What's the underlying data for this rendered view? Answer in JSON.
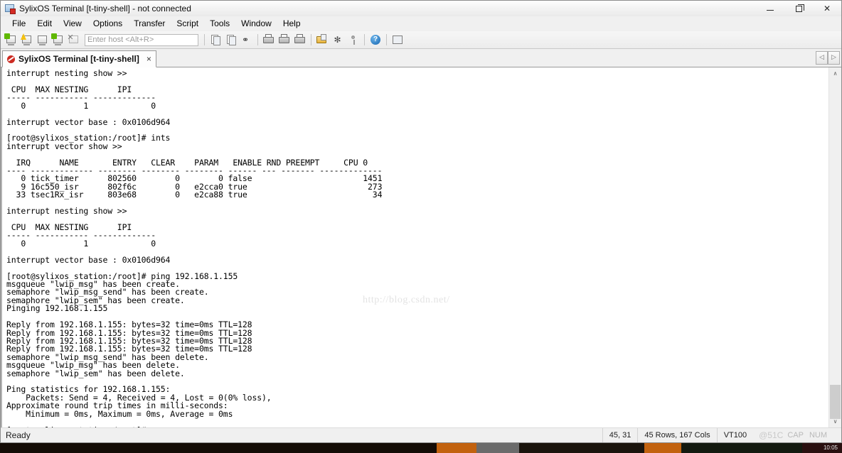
{
  "window": {
    "title": "SylixOS Terminal [t-tiny-shell] - not connected",
    "icon": "terminal-app-icon",
    "minimize": "minimize-icon",
    "maximize": "restore-icon",
    "close": "close-icon"
  },
  "menubar": {
    "items": [
      {
        "label": "File"
      },
      {
        "label": "Edit"
      },
      {
        "label": "View"
      },
      {
        "label": "Options"
      },
      {
        "label": "Transfer"
      },
      {
        "label": "Script"
      },
      {
        "label": "Tools"
      },
      {
        "label": "Window"
      },
      {
        "label": "Help"
      }
    ]
  },
  "toolbar": {
    "host_placeholder": "Enter host <Alt+R>",
    "host_value": "",
    "icons": [
      {
        "name": "connect-icon"
      },
      {
        "name": "quick-connect-icon"
      },
      {
        "name": "connect-in-tab-icon"
      },
      {
        "name": "reconnect-icon"
      },
      {
        "name": "disconnect-icon"
      },
      {
        "name": "copy-icon"
      },
      {
        "name": "paste-icon"
      },
      {
        "name": "find-icon"
      },
      {
        "name": "print-screen-icon"
      },
      {
        "name": "log-session-icon"
      },
      {
        "name": "print-icon"
      },
      {
        "name": "session-options-icon"
      },
      {
        "name": "global-options-icon"
      },
      {
        "name": "key-icon"
      },
      {
        "name": "help-icon"
      },
      {
        "name": "secure-file-transfer-icon"
      }
    ]
  },
  "tabs": {
    "items": [
      {
        "label": "SylixOS Terminal [t-tiny-shell]",
        "close": "×",
        "active": true
      }
    ],
    "nav_prev": "◁",
    "nav_next": "▷"
  },
  "terminal": {
    "watermark": "http://blog.csdn.net/",
    "lines": [
      "interrupt nesting show >>",
      "",
      " CPU  MAX NESTING      IPI",
      "----- ----------- -------------",
      "   0            1             0",
      "",
      "interrupt vector base : 0x0106d964",
      "",
      "[root@sylixos_station:/root]# ints",
      "interrupt vector show >>",
      "",
      "  IRQ      NAME       ENTRY   CLEAR    PARAM   ENABLE RND PREEMPT     CPU 0",
      "---- ------------- -------- -------- -------- ------ --- ------- -------------",
      "   0 tick_timer      802560        0        0 false                       1451",
      "   9 16c550_isr      802f6c        0   e2cca0 true                         273",
      "  33 tsec1Rx_isr     803e68        0   e2ca88 true                          34",
      "",
      "interrupt nesting show >>",
      "",
      " CPU  MAX NESTING      IPI",
      "----- ----------- -------------",
      "   0            1             0",
      "",
      "interrupt vector base : 0x0106d964",
      "",
      "[root@sylixos_station:/root]# ping 192.168.1.155",
      "msgqueue \"lwip_msg\" has been create.",
      "semaphore \"lwip_msg_send\" has been create.",
      "semaphore \"lwip_sem\" has been create.",
      "Pinging 192.168.1.155",
      "",
      "Reply from 192.168.1.155: bytes=32 time=0ms TTL=128",
      "Reply from 192.168.1.155: bytes=32 time=0ms TTL=128",
      "Reply from 192.168.1.155: bytes=32 time=0ms TTL=128",
      "Reply from 192.168.1.155: bytes=32 time=0ms TTL=128",
      "semaphore \"lwip_msg_send\" has been delete.",
      "msgqueue \"lwip_msg\" has been delete.",
      "semaphore \"lwip_sem\" has been delete.",
      "",
      "Ping statistics for 192.168.1.155:",
      "    Packets: Send = 4, Received = 4, Lost = 0(0% loss),",
      "Approximate round trip times in milli-seconds:",
      "    Minimum = 0ms, Maximum = 0ms, Average = 0ms",
      "",
      "[root@sylixos_station:/root]#"
    ],
    "scrollbar": {
      "up_arrow": "∧",
      "down_arrow": "∨"
    }
  },
  "statusbar": {
    "ready": "Ready",
    "cursor_position": "45, 31",
    "dimensions": "45 Rows, 167 Cols",
    "emulation": "VT100",
    "watermark": "@51C",
    "caps": "CAP",
    "num": "NUM"
  },
  "taskbar": {
    "clock": "10:05"
  },
  "colors": {
    "accent": "#cc2b22",
    "terminal_bg": "#ffffff",
    "terminal_fg": "#000000",
    "chrome": "#f0f0f0"
  }
}
